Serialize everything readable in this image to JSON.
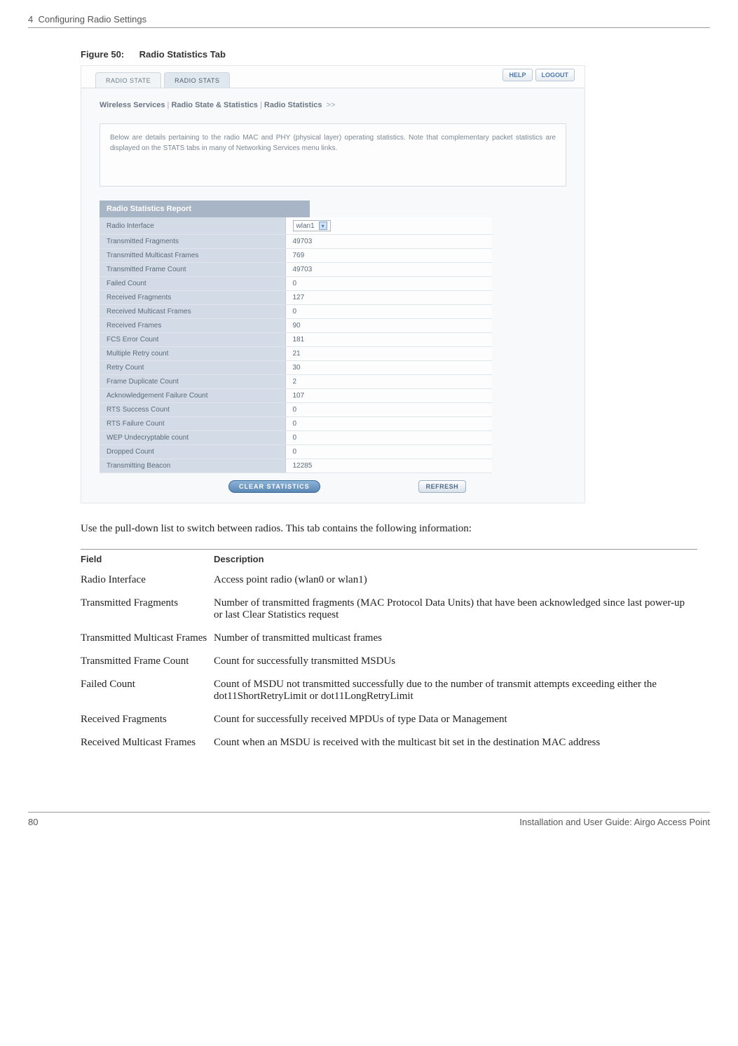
{
  "page_header": {
    "chapter": "4",
    "title": "Configuring Radio Settings"
  },
  "figure": {
    "number": "Figure 50:",
    "title": "Radio Statistics Tab"
  },
  "screenshot": {
    "tabs": {
      "state": "RADIO STATE",
      "stats": "RADIO STATS"
    },
    "buttons": {
      "help": "HELP",
      "logout": "LOGOUT"
    },
    "breadcrumb": {
      "a": "Wireless Services",
      "b": "Radio State & Statistics",
      "c": "Radio Statistics",
      "sep": "|",
      "arrow": ">>"
    },
    "intro": "Below are details pertaining to the radio MAC and PHY (physical layer) operating statistics. Note that complementary packet statistics are displayed on the STATS tabs in many of Networking Services menu links.",
    "section_title": "Radio Statistics Report",
    "rows": [
      {
        "label": "Radio Interface",
        "value": "wlan1",
        "select": true
      },
      {
        "label": "Transmitted Fragments",
        "value": "49703"
      },
      {
        "label": "Transmitted Multicast Frames",
        "value": "769"
      },
      {
        "label": "Transmitted Frame Count",
        "value": "49703"
      },
      {
        "label": "Failed Count",
        "value": "0"
      },
      {
        "label": "Received Fragments",
        "value": "127"
      },
      {
        "label": "Received Multicast Frames",
        "value": "0"
      },
      {
        "label": "Received Frames",
        "value": "90"
      },
      {
        "label": "FCS Error Count",
        "value": "181"
      },
      {
        "label": "Multiple Retry count",
        "value": "21"
      },
      {
        "label": "Retry Count",
        "value": "30"
      },
      {
        "label": "Frame Duplicate Count",
        "value": "2"
      },
      {
        "label": "Acknowledgement Failure Count",
        "value": "107"
      },
      {
        "label": "RTS Success Count",
        "value": "0"
      },
      {
        "label": "RTS Failure Count",
        "value": "0"
      },
      {
        "label": "WEP Undecryptable count",
        "value": "0"
      },
      {
        "label": "Dropped Count",
        "value": "0"
      },
      {
        "label": "Transmitting Beacon",
        "value": "12285"
      }
    ],
    "clear_btn": "CLEAR STATISTICS",
    "refresh_btn": "REFRESH"
  },
  "body_paragraph": "Use the pull-down list to switch between radios. This tab contains the following information:",
  "desc_header": {
    "field": "Field",
    "desc": "Description"
  },
  "descriptions": [
    {
      "field": "Radio Interface",
      "desc": "Access point radio (wlan0 or wlan1)"
    },
    {
      "field": "Transmitted Fragments",
      "desc": "Number of transmitted fragments (MAC Protocol Data Units) that have been acknowledged since last power-up or last Clear Statistics request"
    },
    {
      "field": "Transmitted Multicast Frames",
      "desc": "Number of transmitted multicast frames"
    },
    {
      "field": "Transmitted Frame Count",
      "desc": "Count for successfully transmitted MSDUs"
    },
    {
      "field": "Failed Count",
      "desc": "Count of MSDU not transmitted successfully due to the number of transmit attempts exceeding either the dot11ShortRetryLimit or dot11LongRetryLimit"
    },
    {
      "field": "Received Fragments",
      "desc": "Count for successfully received MPDUs of type Data or Management"
    },
    {
      "field": "Received Multicast Frames",
      "desc": "Count when an MSDU is received with the multicast bit set in the destination MAC address"
    }
  ],
  "page_footer": {
    "num": "80",
    "title": "Installation and User Guide: Airgo Access Point"
  }
}
